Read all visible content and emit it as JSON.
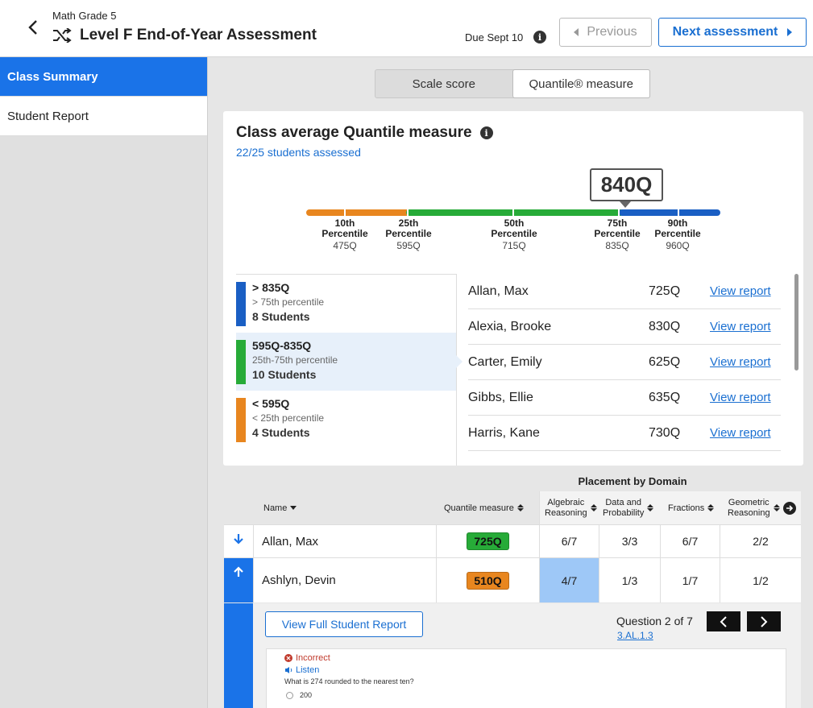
{
  "header": {
    "subject": "Math Grade 5",
    "title": "Level F End-of-Year Assessment",
    "due": "Due Sept 10",
    "previous_label": "Previous",
    "next_label": "Next assessment"
  },
  "sidebar": {
    "items": [
      {
        "label": "Class Summary",
        "active": true
      },
      {
        "label": "Student Report",
        "active": false
      }
    ]
  },
  "toggle": {
    "options": [
      "Scale score",
      "Quantile® measure"
    ],
    "selected": "Quantile® measure"
  },
  "summary": {
    "title": "Class average Quantile measure",
    "assessed": "22/25 students assessed",
    "average": "840Q",
    "percentiles": [
      {
        "name": "10th",
        "suffix": "Percentile",
        "value": "475Q"
      },
      {
        "name": "25th",
        "suffix": "Percentile",
        "value": "595Q"
      },
      {
        "name": "50th",
        "suffix": "Percentile",
        "value": "715Q"
      },
      {
        "name": "75th",
        "suffix": "Percentile",
        "value": "835Q"
      },
      {
        "name": "90th",
        "suffix": "Percentile",
        "value": "960Q"
      }
    ],
    "colors": {
      "low": "#e8861f",
      "mid": "#27ab38",
      "high": "#1a5fc4"
    }
  },
  "bands": [
    {
      "range": "> 835Q",
      "percentile": "> 75th percentile",
      "count": "8 Students",
      "color": "#1a5fc4"
    },
    {
      "range": "595Q-835Q",
      "percentile": "25th-75th percentile",
      "count": "10 Students",
      "color": "#27ab38"
    },
    {
      "range": "< 595Q",
      "percentile": "< 25th percentile",
      "count": "4 Students",
      "color": "#e8861f"
    }
  ],
  "students": [
    {
      "name": "Allan, Max",
      "value": "725Q",
      "link": "View report"
    },
    {
      "name": "Alexia, Brooke",
      "value": "830Q",
      "link": "View report"
    },
    {
      "name": "Carter, Emily",
      "value": "625Q",
      "link": "View report"
    },
    {
      "name": "Gibbs, Ellie",
      "value": "635Q",
      "link": "View report"
    },
    {
      "name": "Harris, Kane",
      "value": "730Q",
      "link": "View report"
    }
  ],
  "table": {
    "placement_header": "Placement by Domain",
    "columns": {
      "name": "Name",
      "quantile": "Quantile measure",
      "algebraic_1": "Algebraic",
      "algebraic_2": "Reasoning",
      "data_1": "Data and",
      "data_2": "Probability",
      "fractions": "Fractions",
      "geometric_1": "Geometric",
      "geometric_2": "Reasoning"
    },
    "rows": [
      {
        "name": "Allan, Max",
        "quantile": "725Q",
        "algebraic": "6/7",
        "data": "3/3",
        "fractions": "6/7",
        "geometric": "2/2"
      },
      {
        "name": "Ashlyn, Devin",
        "quantile": "510Q",
        "algebraic": "4/7",
        "data": "1/3",
        "fractions": "1/7",
        "geometric": "1/2"
      }
    ]
  },
  "expanded": {
    "full_report_label": "View Full Student Report",
    "question_label": "Question 2 of 7",
    "question_code": "3.AL.1.3",
    "status": "Incorrect",
    "listen": "Listen",
    "question_text": "What is 274 rounded to the nearest ten?",
    "first_option": "200"
  }
}
